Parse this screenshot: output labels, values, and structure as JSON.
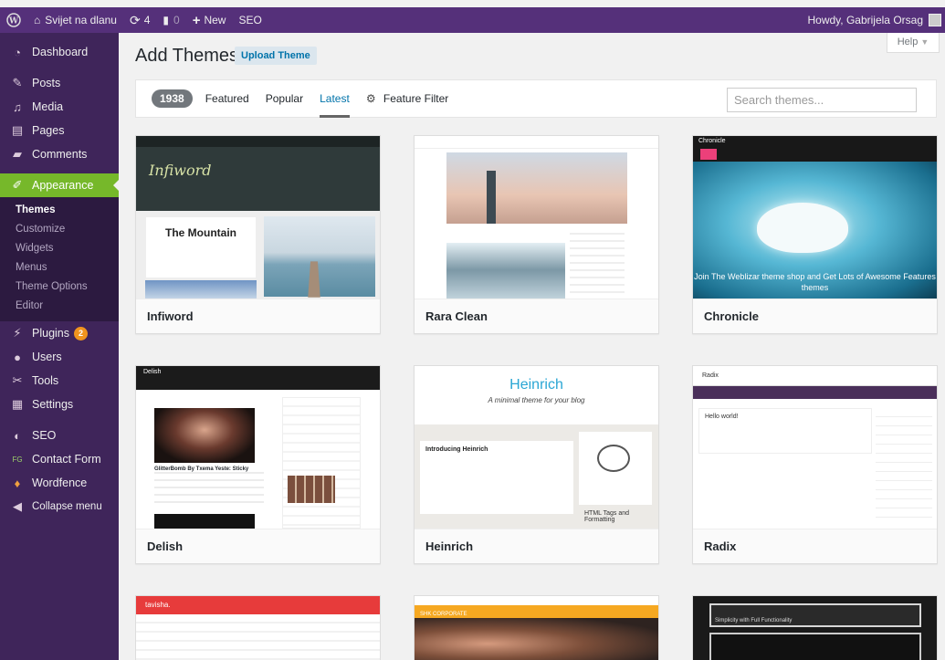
{
  "adminbar": {
    "site_name": "Svijet na dlanu",
    "updates_count": "4",
    "comments_count": "0",
    "new_label": "New",
    "seo_label": "SEO",
    "howdy": "Howdy, Gabrijela Orsag"
  },
  "sidebar": {
    "items": [
      {
        "label": "Dashboard",
        "icon": "dashboard-icon"
      },
      {
        "label": "Posts",
        "icon": "pin-icon"
      },
      {
        "label": "Media",
        "icon": "media-icon"
      },
      {
        "label": "Pages",
        "icon": "pages-icon"
      },
      {
        "label": "Comments",
        "icon": "comment-icon"
      },
      {
        "label": "Appearance",
        "icon": "brush-icon"
      }
    ],
    "submenu": [
      "Themes",
      "Customize",
      "Widgets",
      "Menus",
      "Theme Options",
      "Editor"
    ],
    "items2": [
      {
        "label": "Plugins",
        "icon": "plugin-icon",
        "badge": "2"
      },
      {
        "label": "Users",
        "icon": "users-icon"
      },
      {
        "label": "Tools",
        "icon": "wrench-icon"
      },
      {
        "label": "Settings",
        "icon": "settings-icon"
      },
      {
        "label": "SEO",
        "icon": "seo-icon"
      },
      {
        "label": "Contact Form",
        "icon": "form-icon",
        "icon_text": "FG"
      },
      {
        "label": "Wordfence",
        "icon": "shield-icon"
      },
      {
        "label": "Collapse menu",
        "icon": "collapse-icon"
      }
    ]
  },
  "main": {
    "title": "Add Themes",
    "upload_label": "Upload Theme",
    "help_label": "Help",
    "filter": {
      "count": "1938",
      "featured": "Featured",
      "popular": "Popular",
      "latest": "Latest",
      "feature_filter": "Feature Filter"
    },
    "search": {
      "placeholder": "Search themes..."
    }
  },
  "themes": [
    {
      "name": "Infiword",
      "shot_logo": "Infiword",
      "shot_card_title": "The Mountain"
    },
    {
      "name": "Rara Clean"
    },
    {
      "name": "Chronicle",
      "shot_caption": "Join The Weblizar theme shop and Get Lots of Awesome Features themes",
      "shot_brand": "Chronicle"
    },
    {
      "name": "Delish",
      "shot_brand": "Delish",
      "shot_post": "GlitterBomb By Txema Yeste: Sticky"
    },
    {
      "name": "Heinrich",
      "shot_title": "Heinrich",
      "shot_sub": "A minimal theme for your blog",
      "shot_post": "Introducing Heinrich",
      "shot_caption": "HTML Tags and Formatting"
    },
    {
      "name": "Radix",
      "shot_brand": "Radix",
      "shot_post": "Hello world!"
    }
  ],
  "partial_themes": [
    {
      "shot_brand": "tavisha."
    },
    {
      "shot_brand": "SHK CORPORATE"
    },
    {
      "shot_brand": "Simplicity with Full Functionality"
    }
  ],
  "colors": {
    "adminbar": "#55307a",
    "sidebar": "#3f255a",
    "current": "#76b82a",
    "link": "#0073aa"
  }
}
